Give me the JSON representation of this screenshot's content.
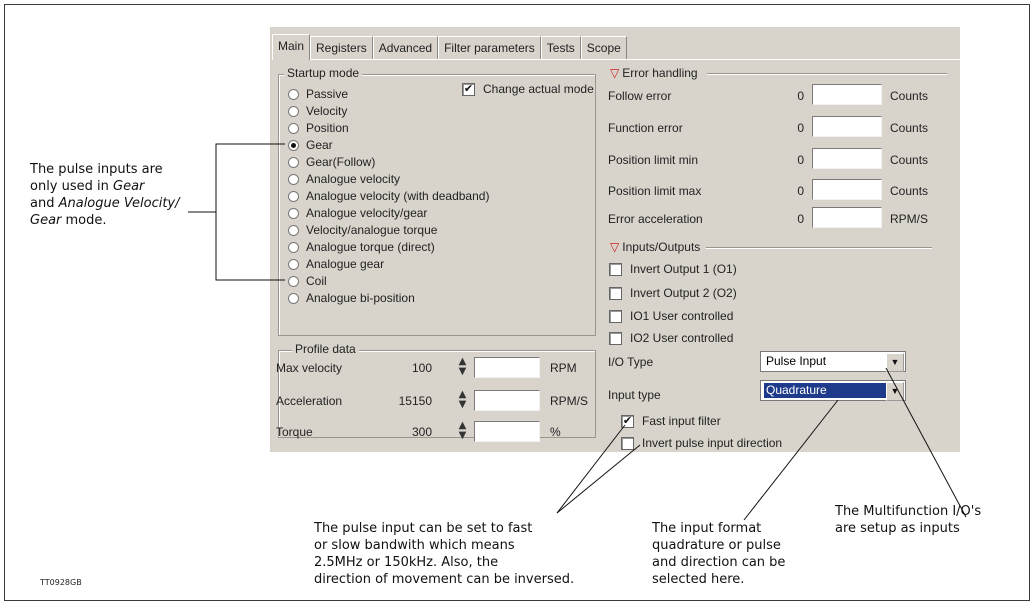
{
  "tabs": [
    "Main",
    "Registers",
    "Advanced",
    "Filter parameters",
    "Tests",
    "Scope"
  ],
  "startup": {
    "legend": "Startup mode",
    "change_actual_mode": "Change actual mode",
    "change_actual_mode_checked": true,
    "options": [
      "Passive",
      "Velocity",
      "Position",
      "Gear",
      "Gear(Follow)",
      "Analogue velocity",
      "Analogue velocity (with deadband)",
      "Analogue velocity/gear",
      "Velocity/analogue torque",
      "Analogue torque (direct)",
      "Analogue gear",
      "Coil",
      "Analogue bi-position"
    ],
    "selected": "Gear"
  },
  "profile": {
    "legend": "Profile data",
    "rows": [
      {
        "label": "Max velocity",
        "value": "100",
        "unit": "RPM"
      },
      {
        "label": "Acceleration",
        "value": "15150",
        "unit": "RPM/S"
      },
      {
        "label": "Torque",
        "value": "300",
        "unit": "%"
      }
    ]
  },
  "errors": {
    "legend": "Error handling",
    "rows": [
      {
        "label": "Follow error",
        "value": "0",
        "unit": "Counts"
      },
      {
        "label": "Function error",
        "value": "0",
        "unit": "Counts"
      },
      {
        "label": "Position limit min",
        "value": "0",
        "unit": "Counts"
      },
      {
        "label": "Position limit max",
        "value": "0",
        "unit": "Counts"
      },
      {
        "label": "Error acceleration",
        "value": "0",
        "unit": "RPM/S"
      }
    ]
  },
  "io": {
    "legend": "Inputs/Outputs",
    "checks": [
      {
        "label": "Invert Output 1 (O1)",
        "checked": false
      },
      {
        "label": "Invert Output 2 (O2)",
        "checked": false
      },
      {
        "label": "IO1 User controlled",
        "checked": false
      },
      {
        "label": "IO2 User controlled",
        "checked": false
      }
    ],
    "io_type_label": "I/O Type",
    "io_type_value": "Pulse Input",
    "input_type_label": "Input type",
    "input_type_value": "Quadrature",
    "fast_filter": {
      "label": "Fast input filter",
      "checked": true
    },
    "invert_pulse": {
      "label": "Invert pulse input direction",
      "checked": false
    }
  },
  "notes": {
    "left": [
      "The pulse inputs are",
      "only used in ",
      "Gear",
      "and ",
      "Analogue Velocity/",
      "Gear",
      " mode."
    ],
    "bottom1": [
      "The pulse input can be set to fast",
      "or slow bandwith which means",
      "2.5MHz or 150kHz. Also, the",
      "direction of movement can be inversed."
    ],
    "bottom2": [
      "The input format",
      "quadrature or pulse",
      "and direction can be",
      "selected here."
    ],
    "bottom3": [
      "The Multifunction I/O's",
      "are setup as inputs"
    ]
  },
  "figure_id": "TT0928GB",
  "icons": {
    "checked": "checkmark-icon",
    "dropdown": "chevron-down-icon",
    "section": "red-triangle-icon"
  }
}
